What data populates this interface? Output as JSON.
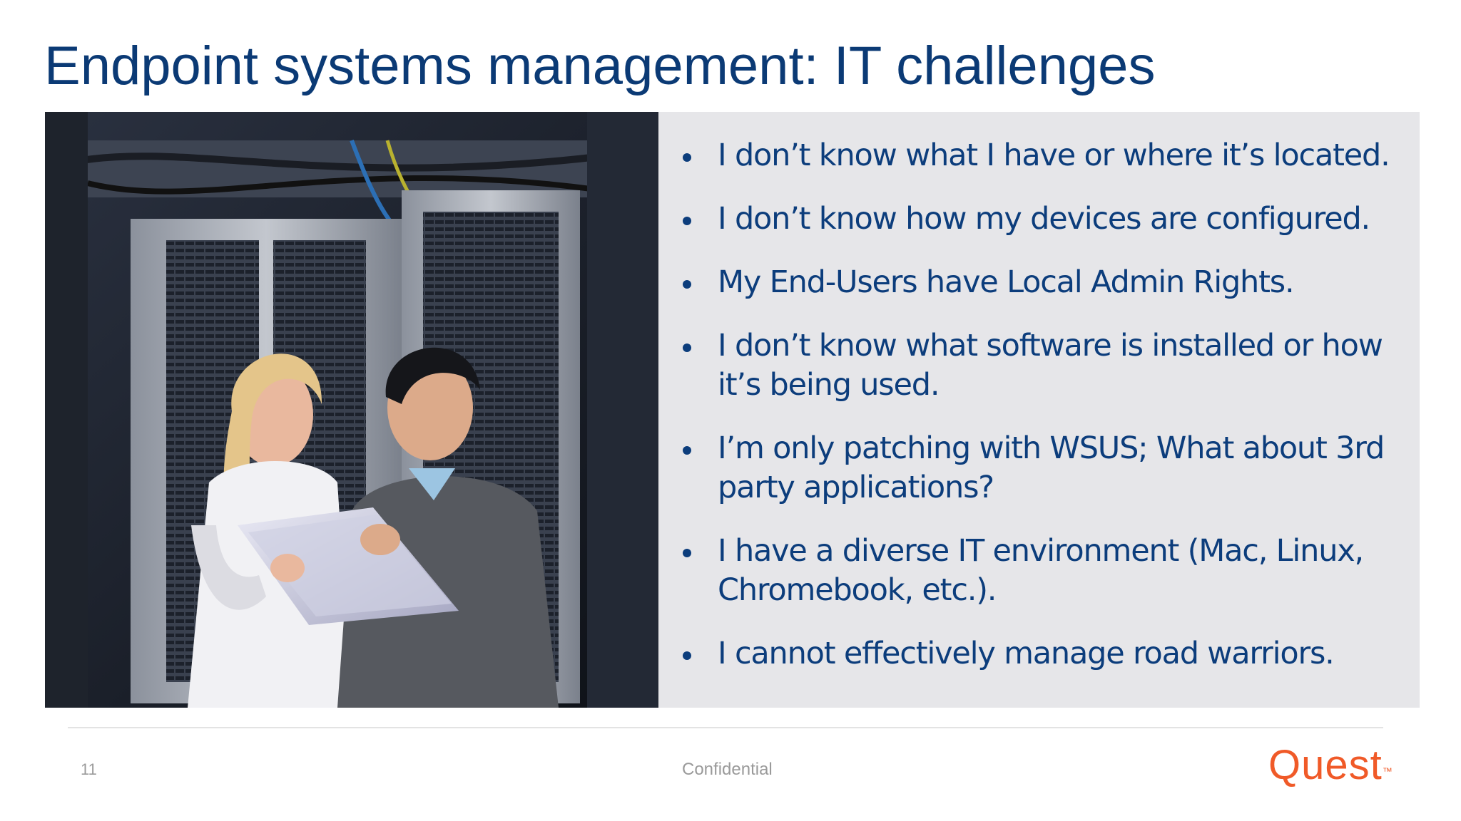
{
  "slide": {
    "title": "Endpoint systems management: IT challenges",
    "title_color": "#0b3a75",
    "bullets": [
      "I don’t know what I have or where it’s located.",
      "I don’t know how my devices are configured.",
      "My End-Users have Local Admin Rights.",
      "I don’t know what software is installed or how it’s being used.",
      "I’m only patching with WSUS; What about 3rd party applications?",
      "I have a diverse IT environment (Mac, Linux, Chromebook, etc.).",
      "I cannot effectively manage road warriors."
    ],
    "bullet_color": "#0c3d7c",
    "panel_color": "#e6e6e9"
  },
  "footer": {
    "page_number": "11",
    "label": "Confidential",
    "brand": "Quest",
    "brand_color": "#f05a28"
  }
}
